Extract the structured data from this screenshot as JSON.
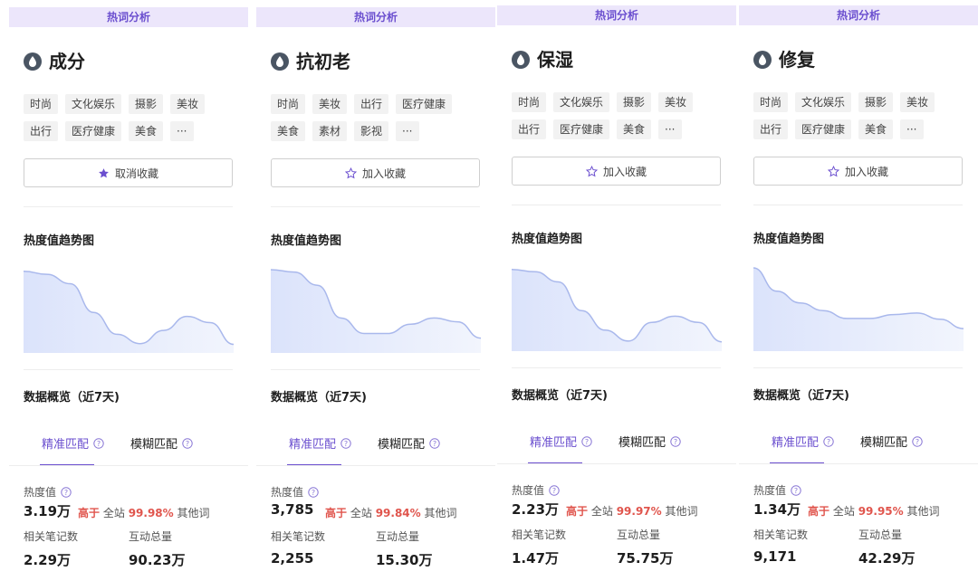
{
  "header_label": "热词分析",
  "fav_active_label": "取消收藏",
  "fav_label": "加入收藏",
  "trend_title": "热度值趋势图",
  "overview_title": "数据概览（近7天)",
  "tab_exact": "精准匹配",
  "tab_fuzzy": "模糊匹配",
  "heat_label": "热度值",
  "higher_word": "高于",
  "site_word": "全站",
  "other_word": "其他词",
  "notes_label": "相关笔记数",
  "interact_label": "互动总量",
  "colors": {
    "accent": "#6b4fcf",
    "highlight": "#e0554d",
    "header_bg": "#ece6fb",
    "chart_line": "#a9b8ec"
  },
  "cards": [
    {
      "keyword": "成分",
      "favorited": true,
      "tags": [
        "时尚",
        "文化娱乐",
        "摄影",
        "美妆",
        "出行",
        "医疗健康",
        "美食",
        "···"
      ],
      "heat": "3.19万",
      "percent": "99.98%",
      "notes": "2.29万",
      "interactions": "90.23万",
      "trend": [
        0.02,
        0.06,
        0.18,
        0.55,
        0.83,
        0.95,
        0.78,
        0.6,
        0.68,
        0.96
      ]
    },
    {
      "keyword": "抗初老",
      "favorited": false,
      "tags": [
        "时尚",
        "美妆",
        "出行",
        "医疗健康",
        "美食",
        "素材",
        "影视",
        "···"
      ],
      "heat": "3,785",
      "percent": "99.84%",
      "notes": "2,255",
      "interactions": "15.30万",
      "trend": [
        0.0,
        0.03,
        0.2,
        0.62,
        0.82,
        0.82,
        0.7,
        0.62,
        0.67,
        0.88
      ]
    },
    {
      "keyword": "保湿",
      "favorited": false,
      "tags": [
        "时尚",
        "文化娱乐",
        "摄影",
        "美妆",
        "出行",
        "医疗健康",
        "美食",
        "···"
      ],
      "heat": "2.23万",
      "percent": "99.97%",
      "notes": "1.47万",
      "interactions": "75.75万",
      "trend": [
        0.02,
        0.05,
        0.18,
        0.55,
        0.8,
        0.94,
        0.7,
        0.62,
        0.7,
        0.95
      ]
    },
    {
      "keyword": "修复",
      "favorited": false,
      "tags": [
        "时尚",
        "文化娱乐",
        "摄影",
        "美妆",
        "出行",
        "医疗健康",
        "美食",
        "···"
      ],
      "heat": "1.34万",
      "percent": "99.95%",
      "notes": "9,171",
      "interactions": "42.29万",
      "trend": [
        0.0,
        0.3,
        0.45,
        0.55,
        0.65,
        0.65,
        0.6,
        0.58,
        0.66,
        0.78
      ]
    }
  ]
}
